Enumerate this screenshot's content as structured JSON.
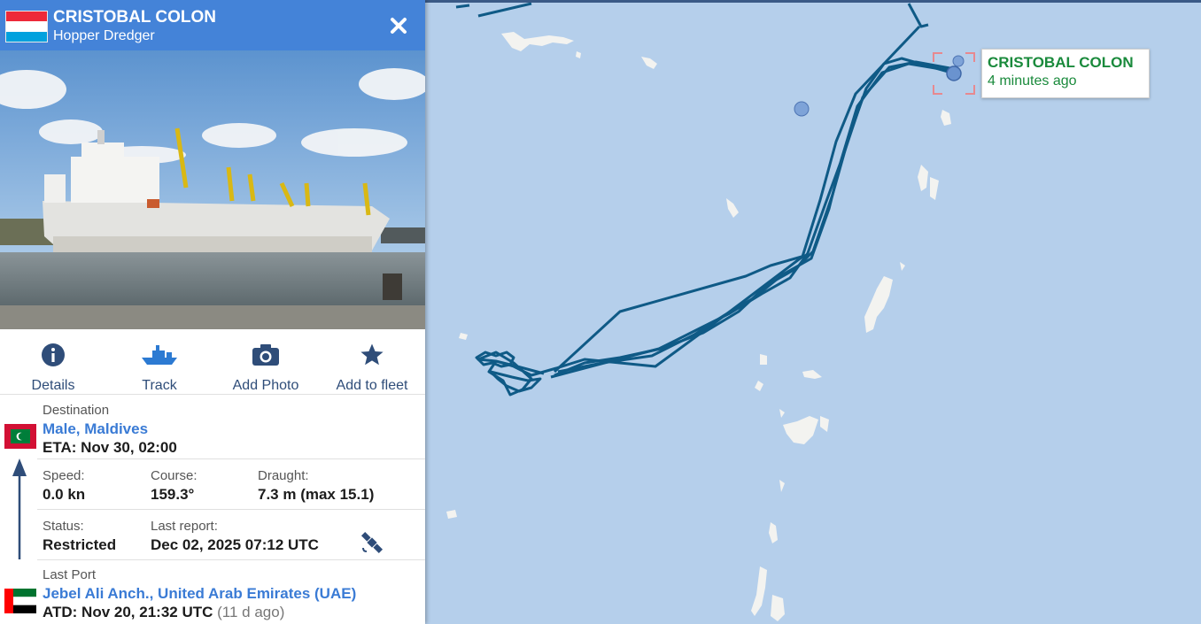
{
  "vessel": {
    "name": "CRISTOBAL COLON",
    "type": "Hopper Dredger",
    "flag_colors": [
      "#ed2939",
      "#ffffff",
      "#00a1de"
    ]
  },
  "actions": [
    {
      "label": "Details",
      "icon": "info-icon"
    },
    {
      "label": "Track",
      "icon": "ship-icon"
    },
    {
      "label": "Add Photo",
      "icon": "camera-icon"
    },
    {
      "label": "Add to fleet",
      "icon": "star-icon"
    }
  ],
  "destination": {
    "label": "Destination",
    "port": "Male, Maldives",
    "eta": "ETA: Nov 30, 02:00"
  },
  "stats": {
    "speed_label": "Speed:",
    "speed": "0.0 kn",
    "course_label": "Course:",
    "course": "159.3°",
    "draught_label": "Draught:",
    "draught": "7.3 m (max 15.1)",
    "status_label": "Status:",
    "status": "Restricted",
    "report_label": "Last report:",
    "report": "Dec 02, 2025 07:12 UTC",
    "report_icon": "satellite-icon"
  },
  "last_port": {
    "label": "Last Port",
    "port": "Jebel Ali Anch., United Arab Emirates (UAE)",
    "atd": "ATD: Nov 20, 21:32 UTC",
    "ago": "(11 d ago)"
  },
  "map": {
    "tooltip_name": "CRISTOBAL COLON",
    "tooltip_age": "4 minutes ago",
    "water_color": "#b5cfeb",
    "track_color": "#0f5a86",
    "island_color": "#f3f3f0"
  }
}
